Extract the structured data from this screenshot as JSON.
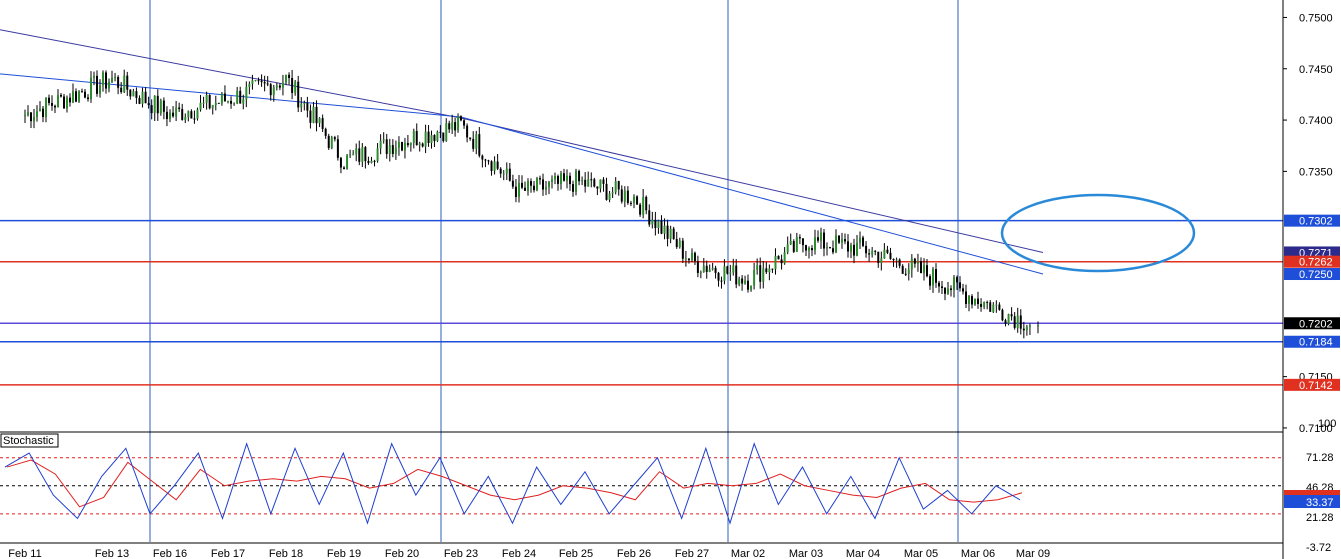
{
  "colors": {
    "background": "#ffffff",
    "axis": "#000000",
    "grid_vertical": "#2e5fbf",
    "candle_up": "#2e8b2e",
    "candle_down": "#000000",
    "ma_fast": "#1f4fd8",
    "ma_slow": "#3a3aa0",
    "level_blue": "#1f4fd8",
    "level_red": "#e03020",
    "level_purple": "#5a4ad8",
    "ellipse": "#2a8ad8",
    "stoch_main": "#1f3fd0",
    "stoch_signal": "#e02020",
    "label_blue_bg": "#1f4fd8",
    "label_red_bg": "#e03020",
    "label_black_bg": "#000000",
    "label_navy_bg": "#2c2a8a"
  },
  "chart_data": {
    "type": "line",
    "instrument_panel": {
      "ylim": [
        0.7098,
        0.7517
      ],
      "y_ticks": [
        "0.7500",
        "0.7450",
        "0.7400",
        "0.7350",
        "0.7150",
        "0.7100"
      ],
      "x_labels": [
        "Feb 11",
        "Feb 13",
        "Feb 16",
        "Feb 17",
        "Feb 18",
        "Feb 19",
        "Feb 20",
        "Feb 23",
        "Feb 24",
        "Feb 25",
        "Feb 26",
        "Feb 27",
        "Mar 02",
        "Mar 03",
        "Mar 04",
        "Mar 05",
        "Mar 06",
        "Mar 09"
      ],
      "close_series": [
        {
          "x": "Feb 11",
          "y": 0.7405
        },
        {
          "x": "Feb 12",
          "y": 0.744
        },
        {
          "x": "Feb 13",
          "y": 0.7405
        },
        {
          "x": "Feb 16",
          "y": 0.742
        },
        {
          "x": "Feb 17",
          "y": 0.744
        },
        {
          "x": "Feb 18",
          "y": 0.736
        },
        {
          "x": "Feb 19",
          "y": 0.738
        },
        {
          "x": "Feb 20",
          "y": 0.7395
        },
        {
          "x": "Feb 23",
          "y": 0.733
        },
        {
          "x": "Feb 24",
          "y": 0.734
        },
        {
          "x": "Feb 25",
          "y": 0.7325
        },
        {
          "x": "Feb 26",
          "y": 0.7262
        },
        {
          "x": "Feb 27",
          "y": 0.7245
        },
        {
          "x": "Mar 02",
          "y": 0.7282
        },
        {
          "x": "Mar 03",
          "y": 0.7275
        },
        {
          "x": "Mar 04",
          "y": 0.7252
        },
        {
          "x": "Mar 05",
          "y": 0.7225
        },
        {
          "x": "Mar 06",
          "y": 0.72
        }
      ],
      "moving_averages": [
        {
          "name": "",
          "values_at": [
            "Feb 11",
            "Feb 20",
            "Mar 06"
          ],
          "y": [
            0.7488,
            0.7402,
            0.7271
          ]
        },
        {
          "name": "",
          "values_at": [
            "Feb 11",
            "Feb 20",
            "Mar 06"
          ],
          "y": [
            0.7445,
            0.7403,
            0.725
          ]
        }
      ],
      "horizontal_levels": [
        {
          "value": "0.7302",
          "color": "blue"
        },
        {
          "value": "0.7271",
          "color": "navy"
        },
        {
          "value": "0.7262",
          "color": "red"
        },
        {
          "value": "0.7250",
          "color": "blue"
        },
        {
          "value": "0.7202",
          "color": "black"
        },
        {
          "value": "0.7184",
          "color": "blue"
        },
        {
          "value": "0.7142",
          "color": "red"
        }
      ]
    },
    "oscillator_panel": {
      "name": "Stochastic",
      "y_ticks": [
        "100",
        "71.28",
        "46.28",
        "21.28",
        "-3.72"
      ],
      "levels": [
        80,
        50,
        20
      ],
      "current_value": "33.37",
      "series": [
        {
          "name": "",
          "values": [
            70,
            85,
            40,
            15,
            60,
            90,
            20,
            50,
            85,
            15,
            95,
            20,
            90,
            30,
            85,
            10,
            95,
            40,
            80,
            20,
            60,
            10,
            70,
            30,
            65,
            20,
            50,
            80,
            15,
            90,
            10,
            95,
            30,
            70,
            20,
            60,
            15,
            80,
            25,
            45,
            20,
            50,
            35
          ]
        }
      ]
    }
  }
}
